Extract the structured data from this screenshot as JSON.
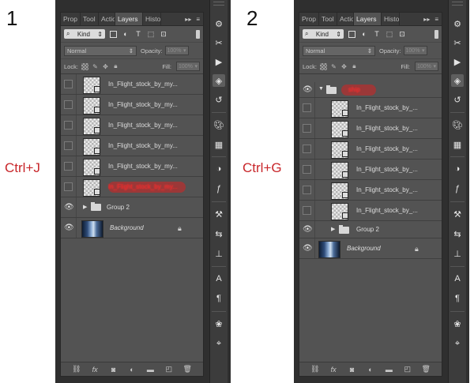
{
  "steps": [
    {
      "number": "1",
      "shortcut": "Ctrl+J"
    },
    {
      "number": "2",
      "shortcut": "Ctrl+G"
    }
  ],
  "panel": {
    "tabs": [
      "Prop",
      "Tool",
      "Actio",
      "Layers",
      "Histo"
    ],
    "active_tab": "Layers",
    "tab_controls": [
      "▸▸",
      "≡"
    ],
    "filter_label": "Kind",
    "blend_mode": "Normal",
    "opacity_label": "Opacity:",
    "opacity_value": "100%",
    "lock_label": "Lock:",
    "fill_label": "Fill:",
    "fill_value": "100%"
  },
  "colors": {
    "panel_bg": "#535353",
    "shortcut_text": "#c8262a",
    "highlight_red": "#e02b2b"
  },
  "screen1": {
    "layers": [
      {
        "name": "In_Flight_stock_by_my...",
        "visible": false,
        "kind": "smart"
      },
      {
        "name": "In_Flight_stock_by_my...",
        "visible": false,
        "kind": "smart"
      },
      {
        "name": "In_Flight_stock_by_my...",
        "visible": false,
        "kind": "smart"
      },
      {
        "name": "In_Flight_stock_by_my...",
        "visible": false,
        "kind": "smart"
      },
      {
        "name": "In_Flight_stock_by_my...",
        "visible": false,
        "kind": "smart"
      },
      {
        "name": "In_Flight_stock_by_my...",
        "visible": false,
        "kind": "smart",
        "highlighted": true
      },
      {
        "name": "Group 2",
        "visible": true,
        "kind": "group"
      },
      {
        "name": "Background",
        "visible": true,
        "kind": "background",
        "locked": true
      }
    ]
  },
  "screen2": {
    "layers": [
      {
        "name": "ship",
        "visible": true,
        "kind": "group-open",
        "highlighted": true
      },
      {
        "name": "In_Flight_stock_by_...",
        "visible": false,
        "kind": "smart"
      },
      {
        "name": "In_Flight_stock_by_...",
        "visible": false,
        "kind": "smart"
      },
      {
        "name": "In_Flight_stock_by_...",
        "visible": false,
        "kind": "smart"
      },
      {
        "name": "In_Flight_stock_by_...",
        "visible": false,
        "kind": "smart"
      },
      {
        "name": "In_Flight_stock_by_...",
        "visible": false,
        "kind": "smart"
      },
      {
        "name": "In_Flight_stock_by_...",
        "visible": false,
        "kind": "smart"
      },
      {
        "name": "Group 2",
        "visible": true,
        "kind": "group"
      },
      {
        "name": "Background",
        "visible": true,
        "kind": "background",
        "locked": true
      }
    ]
  },
  "icons": {
    "eye": "eye-icon",
    "folder": "folder-icon",
    "lock": "lock-icon",
    "filter_icons": [
      "image-filter-icon",
      "adjustment-filter-icon",
      "type-filter-icon",
      "shape-filter-icon",
      "smart-object-filter-icon"
    ],
    "lock_icons": [
      "lock-transparent-icon",
      "lock-image-icon",
      "lock-position-icon",
      "lock-all-icon"
    ],
    "bottom_icons": [
      "link-layers-icon",
      "fx-icon",
      "add-mask-icon",
      "adjustment-layer-icon",
      "new-group-icon",
      "new-layer-icon",
      "trash-icon"
    ],
    "tool_icons": [
      "tool-presets-icon",
      "tools-icon",
      "play-icon",
      "layers-panel-icon",
      "history-icon",
      "color-icon",
      "swatches-icon",
      "styles-icon",
      "fx-panel-icon",
      "brush-icon",
      "adjustments-icon",
      "clone-source-icon",
      "character-icon",
      "paragraph-icon",
      "color-sampler-icon",
      "paths-icon"
    ]
  }
}
